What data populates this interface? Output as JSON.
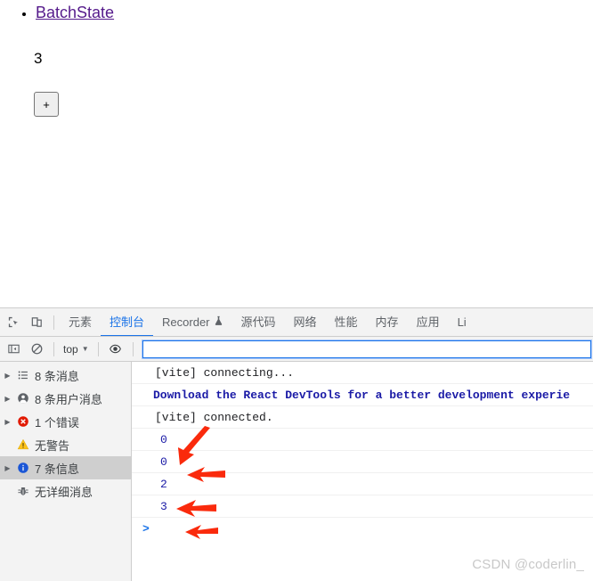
{
  "page": {
    "link_label": "BatchState",
    "counter_value": "3",
    "increment_label": "+"
  },
  "devtools": {
    "toolbar_icons": {
      "inspect": "inspect-element-icon",
      "device": "device-toolbar-icon",
      "sidebar_toggle": "console-sidebar-toggle-icon",
      "clear": "clear-console-icon",
      "eye": "live-expression-eye-icon"
    },
    "tabs": [
      {
        "label": "元素",
        "active": false
      },
      {
        "label": "控制台",
        "active": true
      },
      {
        "label": "Recorder",
        "active": false,
        "icon": "experiment-flask-icon"
      },
      {
        "label": "源代码",
        "active": false
      },
      {
        "label": "网络",
        "active": false
      },
      {
        "label": "性能",
        "active": false
      },
      {
        "label": "内存",
        "active": false
      },
      {
        "label": "应用",
        "active": false
      },
      {
        "label": "Li",
        "active": false
      }
    ],
    "filterbar": {
      "context": "top",
      "caret": "▼",
      "filter_value": "",
      "filter_placeholder": ""
    },
    "sidebar": [
      {
        "label": "8 条消息",
        "icon": "list-icon",
        "expandable": true,
        "selected": false
      },
      {
        "label": "8 条用户消息",
        "icon": "user-icon",
        "expandable": true,
        "selected": false
      },
      {
        "label": "1 个错误",
        "icon": "error-icon",
        "expandable": true,
        "selected": false
      },
      {
        "label": "无警告",
        "icon": "warning-icon",
        "expandable": false,
        "selected": false
      },
      {
        "label": "7 条信息",
        "icon": "info-icon",
        "expandable": true,
        "selected": true
      },
      {
        "label": "无详细消息",
        "icon": "verbose-bug-icon",
        "expandable": false,
        "selected": false
      }
    ],
    "console_log": [
      {
        "text": "[vite] connecting...",
        "style": "plain"
      },
      {
        "text": "Download the React DevTools for a better development experie",
        "style": "react"
      },
      {
        "text": "[vite] connected.",
        "style": "plain"
      },
      {
        "text": "0",
        "style": "num"
      },
      {
        "text": "0",
        "style": "num"
      },
      {
        "text": "2",
        "style": "num"
      },
      {
        "text": "3",
        "style": "num"
      }
    ],
    "prompt_symbol": ">"
  },
  "watermark": "CSDN @coderlin_",
  "colors": {
    "accent": "#1a73e8",
    "visited_link": "#551a8b",
    "error": "#d93025",
    "warning": "#f9ab00",
    "info": "#1a73e8",
    "annotation": "#fa2a0c"
  }
}
